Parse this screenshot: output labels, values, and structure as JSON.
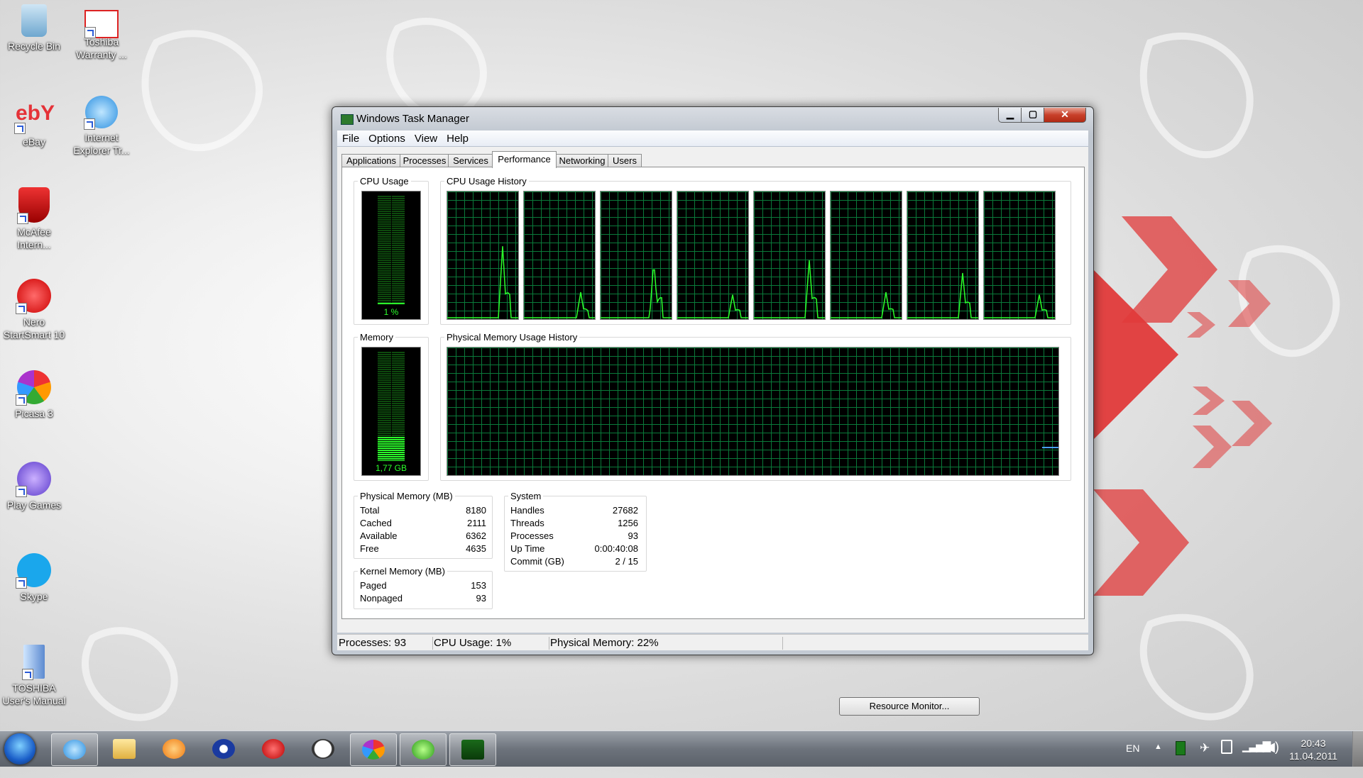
{
  "desktop": {
    "icons": [
      {
        "label": "Recycle Bin",
        "icon": "recycle-bin-icon"
      },
      {
        "label": "Toshiba\nWarranty ...",
        "icon": "toshiba-warranty-icon"
      },
      {
        "label": "eBay",
        "icon": "ebay-icon"
      },
      {
        "label": "Internet\nExplorer Tr...",
        "icon": "internet-explorer-icon"
      },
      {
        "label": "McAfee\nIntern...",
        "icon": "mcafee-icon"
      },
      {
        "label": "Nero\nStartSmart 10",
        "icon": "nero-icon"
      },
      {
        "label": "Picasa 3",
        "icon": "picasa-icon"
      },
      {
        "label": "Play Games",
        "icon": "play-games-icon"
      },
      {
        "label": "Skype",
        "icon": "skype-icon"
      },
      {
        "label": "TOSHIBA\nUser's Manual",
        "icon": "toshiba-manual-icon"
      }
    ],
    "ebay_logo_text": "ebY"
  },
  "window": {
    "title": "Windows Task Manager",
    "close_glyph": "✕",
    "min_glyph": "▁",
    "max_glyph": "▢",
    "menu": [
      "File",
      "Options",
      "View",
      "Help"
    ],
    "tabs": [
      "Applications",
      "Processes",
      "Services",
      "Performance",
      "Networking",
      "Users"
    ],
    "active_tab": "Performance",
    "groups": {
      "cpu_usage": "CPU Usage",
      "cpu_history": "CPU Usage History",
      "memory": "Memory",
      "memory_history": "Physical Memory Usage History",
      "physical_memory": "Physical Memory (MB)",
      "kernel_memory": "Kernel Memory (MB)",
      "system": "System"
    },
    "cpu_meter": {
      "value_text": "1 %",
      "percent": 1
    },
    "memory_meter": {
      "value_text": "1,77 GB",
      "percent": 22
    },
    "cpu_cores": 8,
    "physical_memory": [
      {
        "key": "Total",
        "value": "8180"
      },
      {
        "key": "Cached",
        "value": "2111"
      },
      {
        "key": "Available",
        "value": "6362"
      },
      {
        "key": "Free",
        "value": "4635"
      }
    ],
    "kernel_memory": [
      {
        "key": "Paged",
        "value": "153"
      },
      {
        "key": "Nonpaged",
        "value": "93"
      }
    ],
    "system": [
      {
        "key": "Handles",
        "value": "27682"
      },
      {
        "key": "Threads",
        "value": "1256"
      },
      {
        "key": "Processes",
        "value": "93"
      },
      {
        "key": "Up Time",
        "value": "0:00:40:08"
      },
      {
        "key": "Commit (GB)",
        "value": "2 / 15"
      }
    ],
    "resource_monitor_button": "Resource Monitor...",
    "status": {
      "processes": "Processes: 93",
      "cpu": "CPU Usage: 1%",
      "memory": "Physical Memory: 22%"
    }
  },
  "taskbar": {
    "pinned": [
      "internet-explorer-icon",
      "folder-icon",
      "media-player-icon",
      "user-icon",
      "pushpin-icon",
      "clock-icon",
      "picasa-icon",
      "green-app-icon",
      "task-manager-icon"
    ],
    "language": "EN",
    "time": "20:43",
    "date": "11.04.2011"
  },
  "colors": {
    "graph_line": "#2bff2b",
    "graph_grid": "#0a7a3a",
    "wallpaper_accent": "#e03030"
  }
}
